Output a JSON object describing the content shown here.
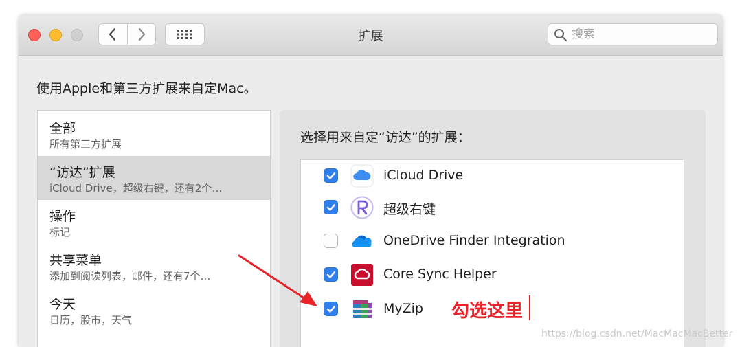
{
  "window": {
    "title": "扩展",
    "search_placeholder": "搜索"
  },
  "intro_text": "使用Apple和第三方扩展来自定Mac。",
  "sidebar": {
    "items": [
      {
        "title": "全部",
        "subtitle": "所有第三方扩展",
        "selected": false
      },
      {
        "title": "“访达”扩展",
        "subtitle": "iCloud Drive，超级右键，还有2个…",
        "selected": true
      },
      {
        "title": "操作",
        "subtitle": "标记",
        "selected": false
      },
      {
        "title": "共享菜单",
        "subtitle": "添加到阅读列表，邮件，还有7个…",
        "selected": false
      },
      {
        "title": "今天",
        "subtitle": "日历，股市，天气",
        "selected": false
      }
    ]
  },
  "panel": {
    "label": "选择用来自定“访达”的扩展：",
    "extensions": [
      {
        "name": "iCloud Drive",
        "checked": true,
        "icon": "icloud-icon"
      },
      {
        "name": "超级右键",
        "checked": true,
        "icon": "super-right-click-icon"
      },
      {
        "name": "OneDrive Finder Integration",
        "checked": false,
        "icon": "onedrive-icon"
      },
      {
        "name": "Core Sync Helper",
        "checked": true,
        "icon": "adobe-creative-cloud-icon"
      },
      {
        "name": "MyZip",
        "checked": true,
        "icon": "myzip-archive-icon"
      }
    ]
  },
  "annotation": {
    "text": "勾选这里",
    "color": "#e8232a"
  },
  "watermark": "https://blog.csdn.net/MacMacMacBetter",
  "colors": {
    "checkbox_accent": "#2f80ed",
    "selection": "#d9d9d9"
  }
}
